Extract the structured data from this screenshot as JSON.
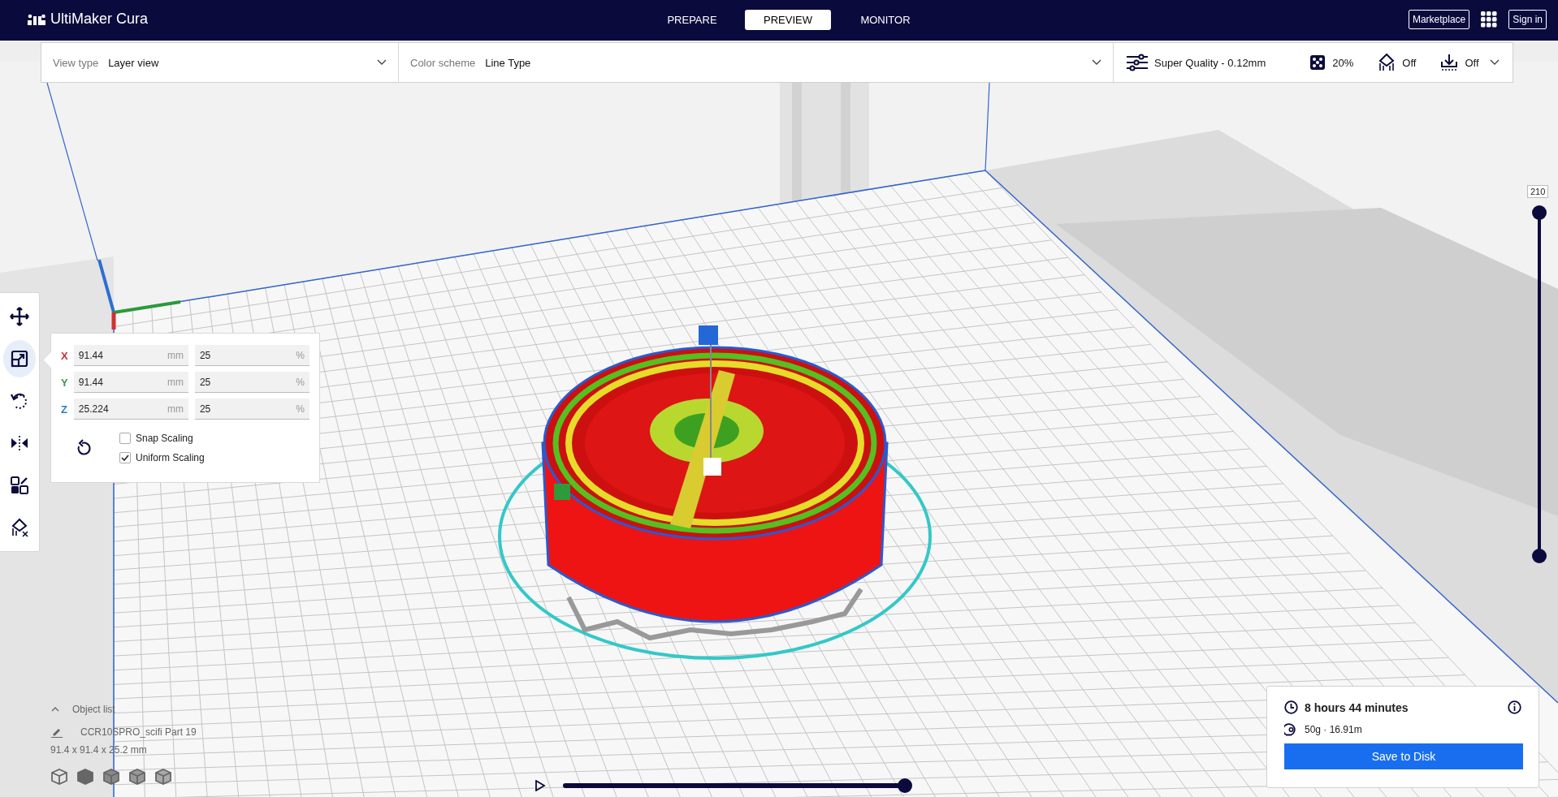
{
  "header": {
    "brand": "UltiMaker Cura",
    "stages": [
      {
        "label": "PREPARE",
        "selected": false
      },
      {
        "label": "PREVIEW",
        "selected": true
      },
      {
        "label": "MONITOR",
        "selected": false
      }
    ],
    "marketplace": "Marketplace",
    "sign_in": "Sign in"
  },
  "view_bar": {
    "view_type": {
      "label": "View type",
      "value": "Layer view"
    },
    "color_scheme": {
      "label": "Color scheme",
      "value": "Line Type"
    },
    "profile": "Super Quality - 0.12mm",
    "infill": "20%",
    "support": "Off",
    "adhesion": "Off"
  },
  "tools": [
    {
      "kind": "move",
      "selected": false
    },
    {
      "kind": "scale",
      "selected": true
    },
    {
      "kind": "rotate",
      "selected": false
    },
    {
      "kind": "mirror",
      "selected": false
    },
    {
      "kind": "per-model",
      "selected": false
    },
    {
      "kind": "support-blocker",
      "selected": false
    }
  ],
  "scale_panel": {
    "rows": [
      {
        "axis": "X",
        "color": "#c8323c",
        "mm": "91.44",
        "mm_unit": "mm",
        "percent": "25",
        "percent_unit": "%"
      },
      {
        "axis": "Y",
        "color": "#3c9650",
        "mm": "91.44",
        "mm_unit": "mm",
        "percent": "25",
        "percent_unit": "%"
      },
      {
        "axis": "Z",
        "color": "#3278c8",
        "mm": "25.224",
        "mm_unit": "mm",
        "percent": "25",
        "percent_unit": "%"
      }
    ],
    "options": [
      {
        "label": "Snap Scaling",
        "checked": false
      },
      {
        "label": "Uniform Scaling",
        "checked": true
      }
    ]
  },
  "object_list": {
    "title": "Object list",
    "expanded": false,
    "object_name": "CCR10SPRO_scifi Part 19",
    "dimensions": "91.4 x 91.4 x 25.2 mm"
  },
  "layer_slider": {
    "reading": "210",
    "upper": {
      "level": 1
    },
    "lower": {
      "level": 0
    }
  },
  "playback": {
    "level": 1
  },
  "print_info": {
    "time": "8 hours 44 minutes",
    "material": "50g · 16.91m",
    "button": "Save to Disk"
  }
}
